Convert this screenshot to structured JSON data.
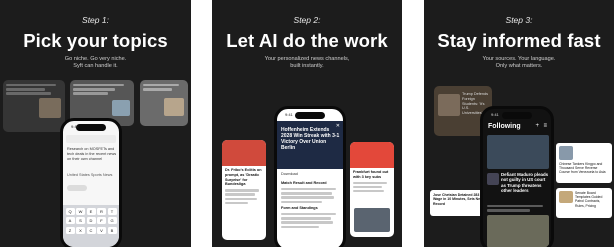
{
  "panels": [
    {
      "step": "Step 1:",
      "headline": "Pick your topics",
      "sub_lines": [
        "Go niche. Go very niche.",
        "Syft can handle it."
      ],
      "chat": {
        "typed_text": "Research on MOSFETs and tech deals in the recent news on their own channel",
        "reply_line": "United States Sports News"
      }
    },
    {
      "step": "Step 2:",
      "headline": "Let AI do the work",
      "sub_lines": [
        "Your personalized news channels,",
        "built instantly."
      ],
      "article": {
        "title": "Hoffenheim Extends 2028 Win Streak with 3-1 Victory Over Union Berlin",
        "left_headline": "Dr. Fribo's Eclitis on prompt, as 'Drastic Surprise' for Bundesliga",
        "right_headline": "Frankfurt found out with 3 key subs",
        "section_1": "Match Result and Record",
        "section_2": "Form and Standings",
        "tab_label": "Download"
      }
    },
    {
      "step": "Step 3:",
      "headline": "Stay informed fast",
      "sub_lines": [
        "Your sources. Your language.",
        "Only what matters."
      ],
      "feed": {
        "title": "Following",
        "top_card": "Trump Defends Foreign Students: 'It's U.S. Universities'",
        "story_1": "Defiant Maduro pleads not guilty in US court as Trump threatens other leaders",
        "story_2": "Jose Chetsian Detained 283 Wage in 10 Minutes, Sets New Record",
        "side_card_1": "Chinese Tankers Kingpo and Thousand Serve Reverse Course from Venezuela to Asia",
        "side_card_2": "Senate Board Templates Guided Patrol Contracts, Rules, Pricing"
      }
    }
  ],
  "colors": {
    "panel_bg": "#1c1c1c",
    "accent_red": "#e3483a",
    "accent_blue": "#2f7de8"
  }
}
